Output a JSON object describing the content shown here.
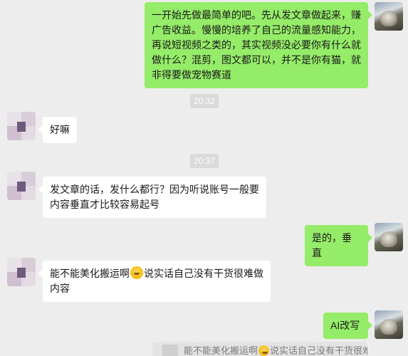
{
  "messages": {
    "m1": "一开始先做最简单的吧。先从发文章做起来，赚广告收益。慢慢的培养了自己的流量感知能力，再说短视频之类的，其实视频没必要你有什么就做什么？混剪，图文都可以，并不是你有猫，就非得要做宠物赛道",
    "m2": "好嘛",
    "m3": "发文章的话，发什么都行？因为听说账号一般要内容垂直才比较容易起号",
    "m4": "是的，垂直",
    "m5_part1": "能不能美化搬运啊",
    "m5_part2": "说实话自己没有干货很难做内容",
    "m6": "AI改写"
  },
  "times": {
    "t1": "20:32",
    "t2": "20:37"
  },
  "quote": {
    "part1": "能不能美化搬运啊",
    "part2": "说实话自己没有干货很难"
  },
  "icons": {
    "self_avatar": "cat-photo-avatar",
    "other_avatar": "pixelated-avatar",
    "emoji": "smiling-emoji"
  },
  "colors": {
    "self_bubble": "#95ec69",
    "other_bubble": "#ffffff",
    "background": "#ededed"
  }
}
